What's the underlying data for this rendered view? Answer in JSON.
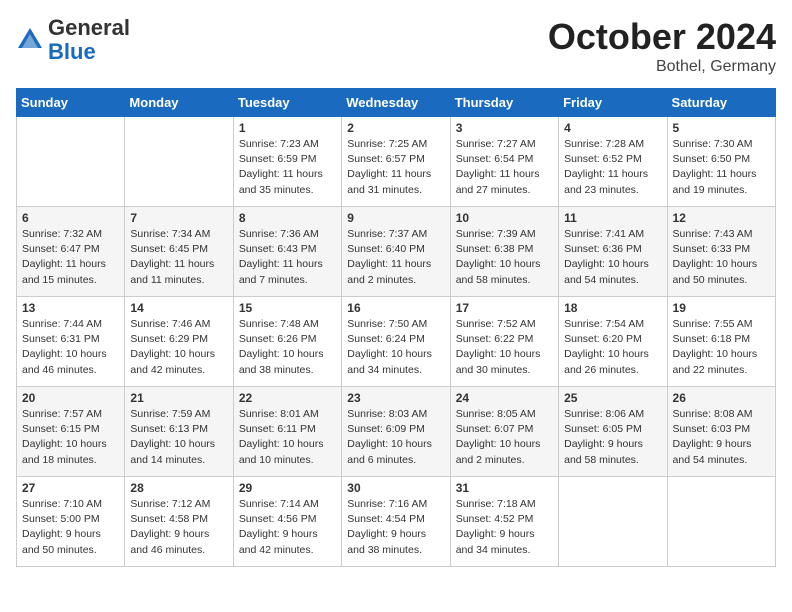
{
  "header": {
    "logo_general": "General",
    "logo_blue": "Blue",
    "month_title": "October 2024",
    "location": "Bothel, Germany"
  },
  "weekdays": [
    "Sunday",
    "Monday",
    "Tuesday",
    "Wednesday",
    "Thursday",
    "Friday",
    "Saturday"
  ],
  "weeks": [
    [
      {
        "day": "",
        "info": ""
      },
      {
        "day": "",
        "info": ""
      },
      {
        "day": "1",
        "info": "Sunrise: 7:23 AM\nSunset: 6:59 PM\nDaylight: 11 hours and 35 minutes."
      },
      {
        "day": "2",
        "info": "Sunrise: 7:25 AM\nSunset: 6:57 PM\nDaylight: 11 hours and 31 minutes."
      },
      {
        "day": "3",
        "info": "Sunrise: 7:27 AM\nSunset: 6:54 PM\nDaylight: 11 hours and 27 minutes."
      },
      {
        "day": "4",
        "info": "Sunrise: 7:28 AM\nSunset: 6:52 PM\nDaylight: 11 hours and 23 minutes."
      },
      {
        "day": "5",
        "info": "Sunrise: 7:30 AM\nSunset: 6:50 PM\nDaylight: 11 hours and 19 minutes."
      }
    ],
    [
      {
        "day": "6",
        "info": "Sunrise: 7:32 AM\nSunset: 6:47 PM\nDaylight: 11 hours and 15 minutes."
      },
      {
        "day": "7",
        "info": "Sunrise: 7:34 AM\nSunset: 6:45 PM\nDaylight: 11 hours and 11 minutes."
      },
      {
        "day": "8",
        "info": "Sunrise: 7:36 AM\nSunset: 6:43 PM\nDaylight: 11 hours and 7 minutes."
      },
      {
        "day": "9",
        "info": "Sunrise: 7:37 AM\nSunset: 6:40 PM\nDaylight: 11 hours and 2 minutes."
      },
      {
        "day": "10",
        "info": "Sunrise: 7:39 AM\nSunset: 6:38 PM\nDaylight: 10 hours and 58 minutes."
      },
      {
        "day": "11",
        "info": "Sunrise: 7:41 AM\nSunset: 6:36 PM\nDaylight: 10 hours and 54 minutes."
      },
      {
        "day": "12",
        "info": "Sunrise: 7:43 AM\nSunset: 6:33 PM\nDaylight: 10 hours and 50 minutes."
      }
    ],
    [
      {
        "day": "13",
        "info": "Sunrise: 7:44 AM\nSunset: 6:31 PM\nDaylight: 10 hours and 46 minutes."
      },
      {
        "day": "14",
        "info": "Sunrise: 7:46 AM\nSunset: 6:29 PM\nDaylight: 10 hours and 42 minutes."
      },
      {
        "day": "15",
        "info": "Sunrise: 7:48 AM\nSunset: 6:26 PM\nDaylight: 10 hours and 38 minutes."
      },
      {
        "day": "16",
        "info": "Sunrise: 7:50 AM\nSunset: 6:24 PM\nDaylight: 10 hours and 34 minutes."
      },
      {
        "day": "17",
        "info": "Sunrise: 7:52 AM\nSunset: 6:22 PM\nDaylight: 10 hours and 30 minutes."
      },
      {
        "day": "18",
        "info": "Sunrise: 7:54 AM\nSunset: 6:20 PM\nDaylight: 10 hours and 26 minutes."
      },
      {
        "day": "19",
        "info": "Sunrise: 7:55 AM\nSunset: 6:18 PM\nDaylight: 10 hours and 22 minutes."
      }
    ],
    [
      {
        "day": "20",
        "info": "Sunrise: 7:57 AM\nSunset: 6:15 PM\nDaylight: 10 hours and 18 minutes."
      },
      {
        "day": "21",
        "info": "Sunrise: 7:59 AM\nSunset: 6:13 PM\nDaylight: 10 hours and 14 minutes."
      },
      {
        "day": "22",
        "info": "Sunrise: 8:01 AM\nSunset: 6:11 PM\nDaylight: 10 hours and 10 minutes."
      },
      {
        "day": "23",
        "info": "Sunrise: 8:03 AM\nSunset: 6:09 PM\nDaylight: 10 hours and 6 minutes."
      },
      {
        "day": "24",
        "info": "Sunrise: 8:05 AM\nSunset: 6:07 PM\nDaylight: 10 hours and 2 minutes."
      },
      {
        "day": "25",
        "info": "Sunrise: 8:06 AM\nSunset: 6:05 PM\nDaylight: 9 hours and 58 minutes."
      },
      {
        "day": "26",
        "info": "Sunrise: 8:08 AM\nSunset: 6:03 PM\nDaylight: 9 hours and 54 minutes."
      }
    ],
    [
      {
        "day": "27",
        "info": "Sunrise: 7:10 AM\nSunset: 5:00 PM\nDaylight: 9 hours and 50 minutes."
      },
      {
        "day": "28",
        "info": "Sunrise: 7:12 AM\nSunset: 4:58 PM\nDaylight: 9 hours and 46 minutes."
      },
      {
        "day": "29",
        "info": "Sunrise: 7:14 AM\nSunset: 4:56 PM\nDaylight: 9 hours and 42 minutes."
      },
      {
        "day": "30",
        "info": "Sunrise: 7:16 AM\nSunset: 4:54 PM\nDaylight: 9 hours and 38 minutes."
      },
      {
        "day": "31",
        "info": "Sunrise: 7:18 AM\nSunset: 4:52 PM\nDaylight: 9 hours and 34 minutes."
      },
      {
        "day": "",
        "info": ""
      },
      {
        "day": "",
        "info": ""
      }
    ]
  ]
}
